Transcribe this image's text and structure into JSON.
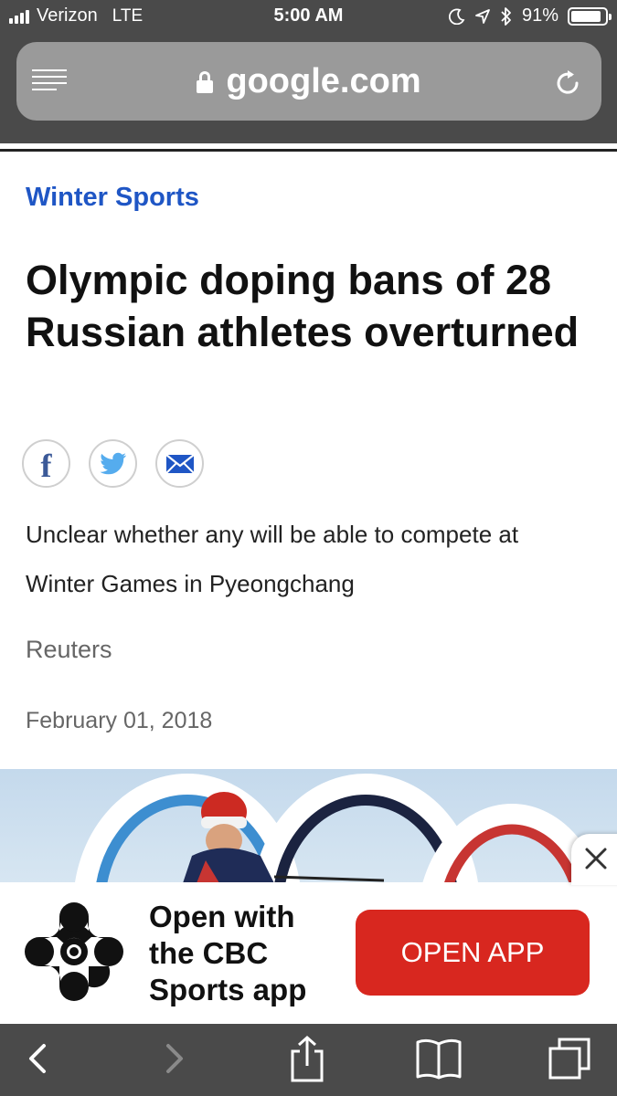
{
  "status_bar": {
    "carrier": "Verizon",
    "network": "LTE",
    "time": "5:00 AM",
    "battery_percent": "91%",
    "battery_level": 0.91,
    "icons": [
      "signal-icon",
      "moon-icon",
      "location-arrow-icon",
      "bluetooth-icon",
      "battery-icon"
    ]
  },
  "url_bar": {
    "url": "google.com",
    "icons": [
      "reader-view-icon",
      "lock-icon",
      "reload-icon"
    ]
  },
  "article": {
    "category": "Winter Sports",
    "headline": "Olympic doping bans of 28 Russian athletes overturned",
    "share": [
      {
        "name": "facebook",
        "icon": "facebook-icon",
        "glyph": "f",
        "color": "#3b5998"
      },
      {
        "name": "twitter",
        "icon": "twitter-bird-icon",
        "color": "#55acee"
      },
      {
        "name": "email",
        "icon": "envelope-icon",
        "color": "#1f56c5"
      }
    ],
    "summary": "Unclear whether any will be able to compete at Winter Games in Pyeongchang",
    "source": "Reuters",
    "date": "February 01, 2018",
    "accent_color": "#1f56c5"
  },
  "app_banner": {
    "logo": "cbc-gem-logo",
    "text": "Open with the CBC Sports app",
    "button_label": "OPEN APP",
    "button_color": "#d8271f",
    "close_icon": "close-icon"
  },
  "toolbar": {
    "items": [
      {
        "name": "back",
        "icon": "chevron-left-icon"
      },
      {
        "name": "forward",
        "icon": "chevron-right-icon"
      },
      {
        "name": "share",
        "icon": "share-icon"
      },
      {
        "name": "bookmarks",
        "icon": "book-icon"
      },
      {
        "name": "tabs",
        "icon": "tabs-icon"
      }
    ]
  }
}
